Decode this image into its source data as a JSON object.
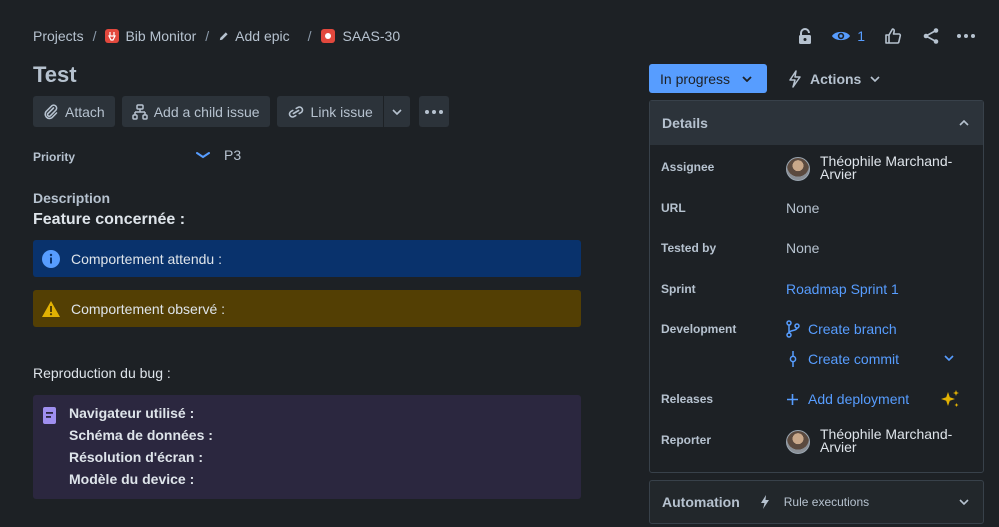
{
  "breadcrumb": {
    "projects": "Projects",
    "project": "Bib Monitor",
    "add_epic": "Add epic",
    "issue_key": "SAAS-30"
  },
  "watchers_count": "1",
  "issue": {
    "title": "Test"
  },
  "toolbar": {
    "attach": "Attach",
    "add_child": "Add a child issue",
    "link_issue": "Link issue"
  },
  "priority": {
    "label": "Priority",
    "value": "P3"
  },
  "description": {
    "label": "Description",
    "heading": "Feature concernée :",
    "info_panel": "Comportement attendu :",
    "warning_panel": "Comportement observé :",
    "repro": "Reproduction du bug :",
    "note_lines": [
      "Navigateur utilisé :",
      "Schéma de données :",
      "Résolution d'écran :",
      "Modèle du device :"
    ]
  },
  "status": {
    "label": "In progress",
    "actions": "Actions"
  },
  "details": {
    "heading": "Details",
    "assignee_label": "Assignee",
    "assignee": "Théophile Marchand-Arvier",
    "url_label": "URL",
    "url": "None",
    "tested_by_label": "Tested by",
    "tested_by": "None",
    "sprint_label": "Sprint",
    "sprint": "Roadmap Sprint 1",
    "development_label": "Development",
    "create_branch": "Create branch",
    "create_commit": "Create commit",
    "releases_label": "Releases",
    "add_deployment": "Add deployment",
    "reporter_label": "Reporter",
    "reporter": "Théophile Marchand-Arvier"
  },
  "automation": {
    "heading": "Automation",
    "rule_executions": "Rule executions"
  },
  "colors": {
    "background": "#1d2125",
    "accent": "#579dff",
    "info_panel": "#09326c",
    "warning_panel": "#533f04",
    "note_panel": "#2b273f"
  }
}
